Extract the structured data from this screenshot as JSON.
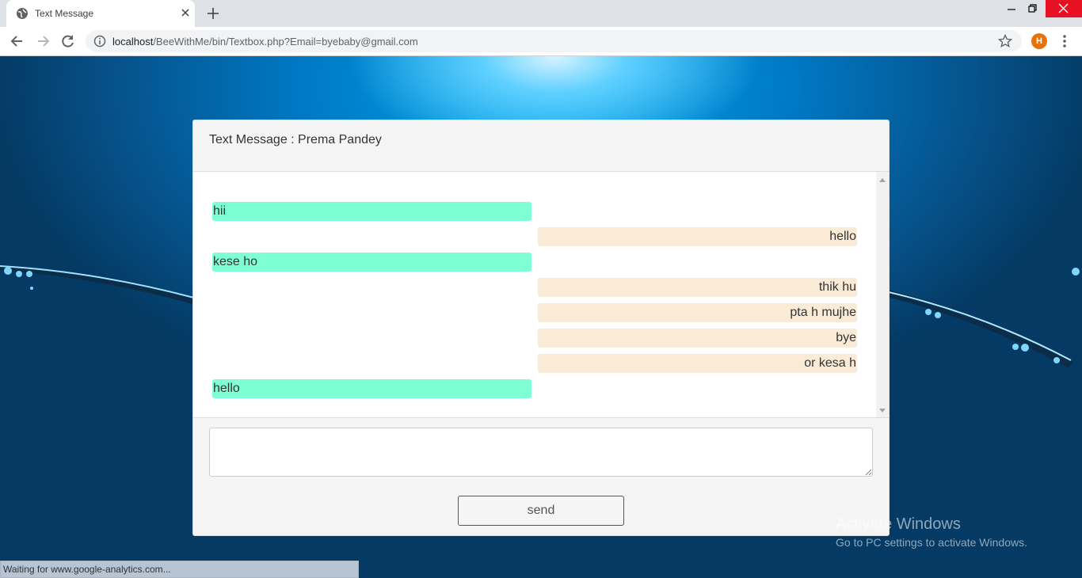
{
  "browser": {
    "tab_title": "Text Message",
    "url_host": "localhost",
    "url_path": "/BeeWithMe/bin/Textbox.php?Email=byebaby@gmail.com",
    "profile_initial": "H",
    "status_text": "Waiting for www.google-analytics.com..."
  },
  "chat": {
    "title": "Text Message : Prema Pandey",
    "messages": [
      {
        "side": "left",
        "text": "hii"
      },
      {
        "side": "right",
        "text": "hello"
      },
      {
        "side": "left",
        "text": "kese ho"
      },
      {
        "side": "right",
        "text": "thik hu"
      },
      {
        "side": "right",
        "text": "pta h mujhe"
      },
      {
        "side": "right",
        "text": "bye"
      },
      {
        "side": "right",
        "text": "or kesa h"
      },
      {
        "side": "left",
        "text": "hello"
      }
    ],
    "input_value": "",
    "send_label": "send"
  },
  "watermark": {
    "line1": "Activate Windows",
    "line2": "Go to PC settings to activate Windows."
  },
  "colors": {
    "incoming_bubble": "#7fffd4",
    "outgoing_bubble": "#faebd7",
    "profile_accent": "#e8710a"
  }
}
